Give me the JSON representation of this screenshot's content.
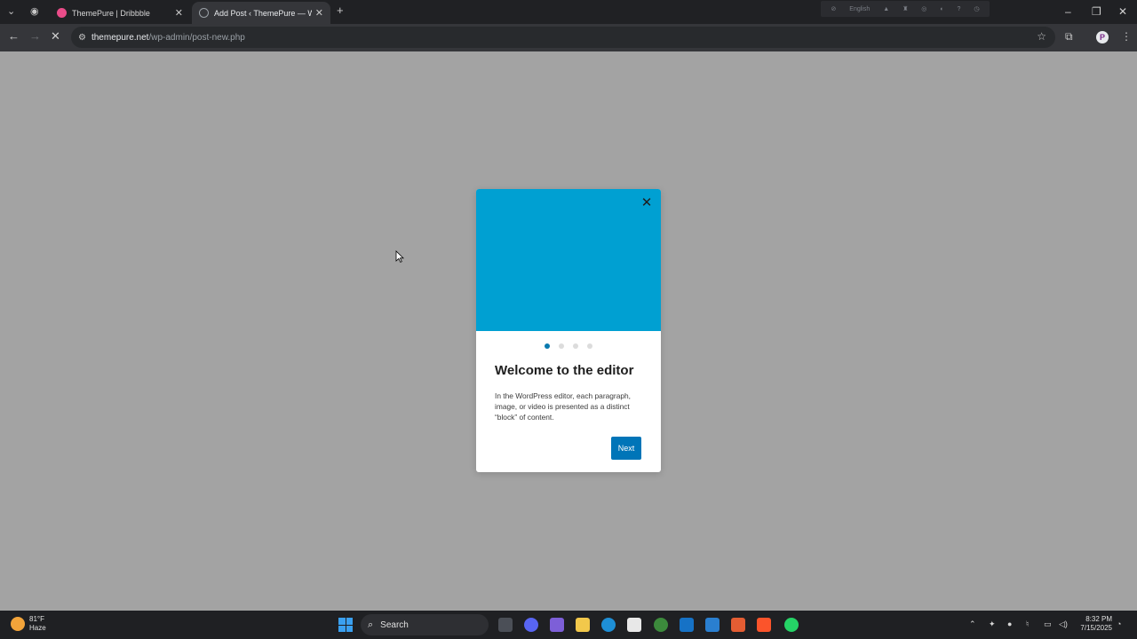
{
  "browser": {
    "tabs": [
      {
        "title": "ThemePure | Dribbble",
        "favicon_color": "#ea4c89",
        "active": false
      },
      {
        "title": "Add Post ‹ ThemePure — Word",
        "favicon_color": "#9aa0a6",
        "active": true
      }
    ],
    "extension_label": "English",
    "url_host": "themepure.net",
    "url_path": "/wp-admin/post-new.php",
    "profile_initial": "P"
  },
  "modal": {
    "title": "Welcome to the editor",
    "body": "In the WordPress editor, each paragraph, image, or video is presented as a distinct “block” of content.",
    "next_label": "Next",
    "hero_color": "#00a0d2",
    "step": 1,
    "total_steps": 4
  },
  "taskbar": {
    "weather_temp": "81°F",
    "weather_cond": "Haze",
    "search_label": "Search",
    "time": "8:32 PM",
    "date": "7/15/2025"
  }
}
